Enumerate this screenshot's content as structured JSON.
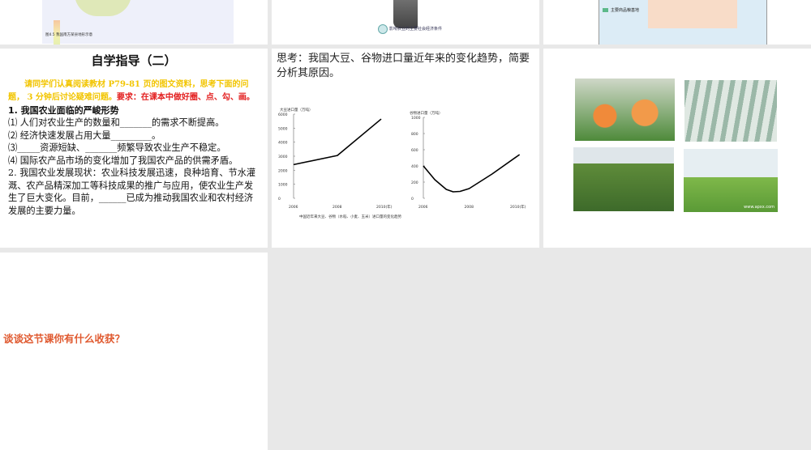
{
  "slides": {
    "s1": {
      "caption": "图4.5 我国南方某县地形示意"
    },
    "s2": {
      "caption": "影响农业的主要社会经济条件"
    },
    "s3": {
      "legend": "主要商品粮基地"
    },
    "s4": {
      "title": "自学指导（二）",
      "instruction": "请同学们认真阅读教材 P79-81 页的图文资料，思考下面的问题， 3 分钟后讨论疑难问题。",
      "requirement": "要求：在课本中做好圈、点、勾、画。",
      "lines": [
        "1. 我国农业面临的严峻形势",
        "⑴ 人们对农业生产的数量和_______的需求不断提高。",
        "⑵ 经济快速发展占用大量_________。",
        "⑶_____资源短缺、_______频繁导致农业生产不稳定。",
        "⑷ 国际农产品市场的变化增加了我国农产品的供需矛盾。",
        "2. 我国农业发展现状：农业科技发展迅速，良种培育、节水灌溉、农产品精深加工等科技成果的推广与应用，使农业生产发生了巨大变化。目前，______已成为推动我国农业和农村经济发展的主要力量。"
      ]
    },
    "s5": {
      "think": "思考：我国大豆、谷物进口量近年来的变化趋势，简要分析其原因。"
    },
    "s6": {
      "watermark": "www.apxx.com"
    },
    "s7": {
      "question": "谈谈这节课你有什么收获？"
    }
  },
  "chart_data": [
    {
      "type": "line",
      "title": "",
      "ylabel": "大豆进口量（万吨）",
      "x": [
        2006,
        2008,
        2010
      ],
      "values": [
        2400,
        3050,
        5650
      ],
      "xticks": [
        "2006",
        "2008",
        "2010(年)"
      ],
      "yticks": [
        "0",
        "1000",
        "2000",
        "3000",
        "4000",
        "5000",
        "6000"
      ],
      "ylim": [
        0,
        6000
      ]
    },
    {
      "type": "line",
      "title": "",
      "ylabel": "谷物进口量（万吨）",
      "x": [
        2006,
        2006.5,
        2007,
        2007.3,
        2007.6,
        2008,
        2009,
        2010.2
      ],
      "values": [
        400,
        230,
        110,
        80,
        85,
        120,
        300,
        540
      ],
      "xticks": [
        "2006",
        "2008",
        "2010(年)"
      ],
      "yticks": [
        "0",
        "200",
        "400",
        "600",
        "800",
        "1000"
      ],
      "ylim": [
        0,
        1000
      ]
    }
  ],
  "chart_caption": "中国近年来大豆、谷物（水稻、小麦、玉米）进口量的变化趋势"
}
